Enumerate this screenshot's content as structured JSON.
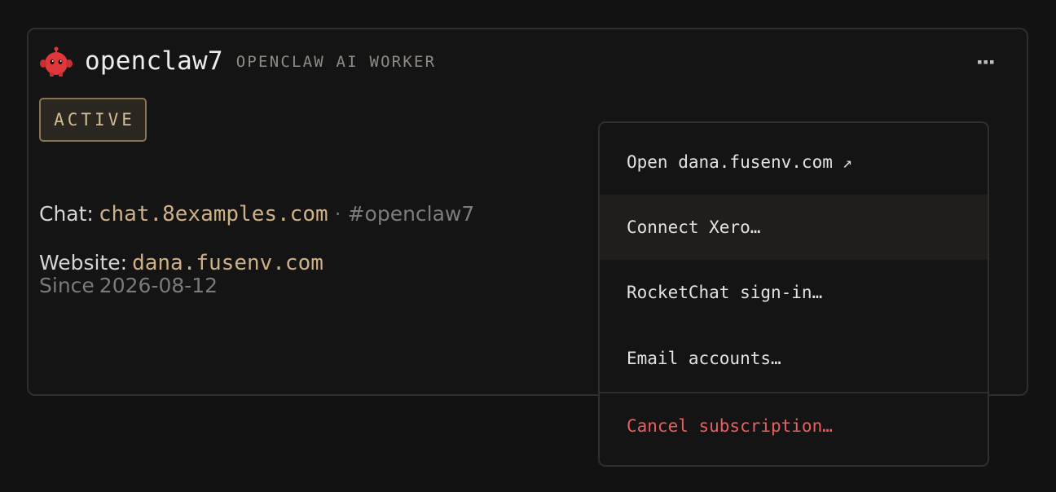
{
  "worker": {
    "name": "openclaw7",
    "type": "OPENCLAW AI WORKER",
    "icon": "red-robot-icon",
    "status": "ACTIVE",
    "chat_label": "Chat:",
    "chat_host": "chat.8examples.com",
    "chat_separator": "·",
    "chat_channel": "#openclaw7",
    "website_label": "Website:",
    "website": "dana.fusenv.com",
    "since_label": "Since",
    "since_date": "2026-08-12"
  },
  "menu": {
    "items": [
      {
        "label": "Open dana.fusenv.com",
        "icon": "external-link-icon",
        "highlighted": false
      },
      {
        "label": "Connect Xero…",
        "highlighted": true
      },
      {
        "label": "RocketChat sign-in…",
        "highlighted": false
      },
      {
        "label": "Email accounts…",
        "highlighted": false
      }
    ],
    "danger_item": {
      "label": "Cancel subscription…"
    }
  },
  "colors": {
    "background": "#121212",
    "accent": "#cdb086",
    "badge_border": "#8a7350",
    "danger": "#ea5e60",
    "robot": "#e0383a"
  }
}
